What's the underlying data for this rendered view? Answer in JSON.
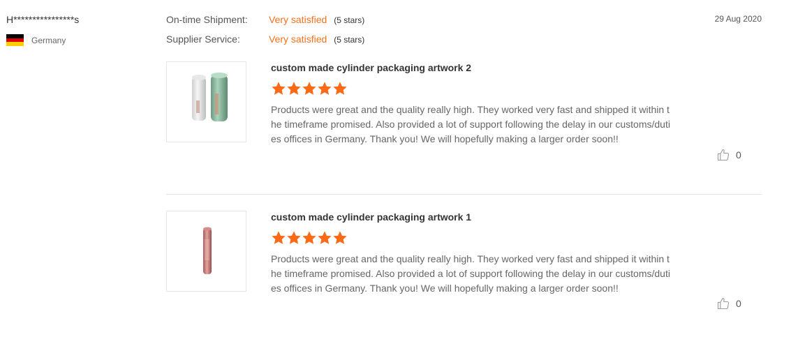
{
  "reviewer": {
    "name": "H****************s",
    "country": "Germany",
    "flag_colors": [
      "#000000",
      "#dd0000",
      "#ffce00"
    ]
  },
  "ratings": [
    {
      "label": "On-time Shipment:",
      "value": "Very satisfied",
      "stars_text": "(5 stars)"
    },
    {
      "label": "Supplier Service:",
      "value": "Very satisfied",
      "stars_text": "(5 stars)"
    }
  ],
  "date": "29 Aug 2020",
  "colors": {
    "accent": "#f7701a",
    "star": "#fb6a17"
  },
  "products": [
    {
      "title": "custom made cylinder packaging artwork 2",
      "rating": 5,
      "text": "Products were great and the quality really high. They worked very fast and shipped it within the timeframe promised. Also provided a lot of support following the delay in our customs/duties offices in Germany. Thank you! We will hopefully making a larger order soon!!",
      "likes": "0"
    },
    {
      "title": "custom made cylinder packaging artwork 1",
      "rating": 5,
      "text": "Products were great and the quality really high. They worked very fast and shipped it within the timeframe promised. Also provided a lot of support following the delay in our customs/duties offices in Germany. Thank you! We will hopefully making a larger order soon!!",
      "likes": "0"
    }
  ]
}
